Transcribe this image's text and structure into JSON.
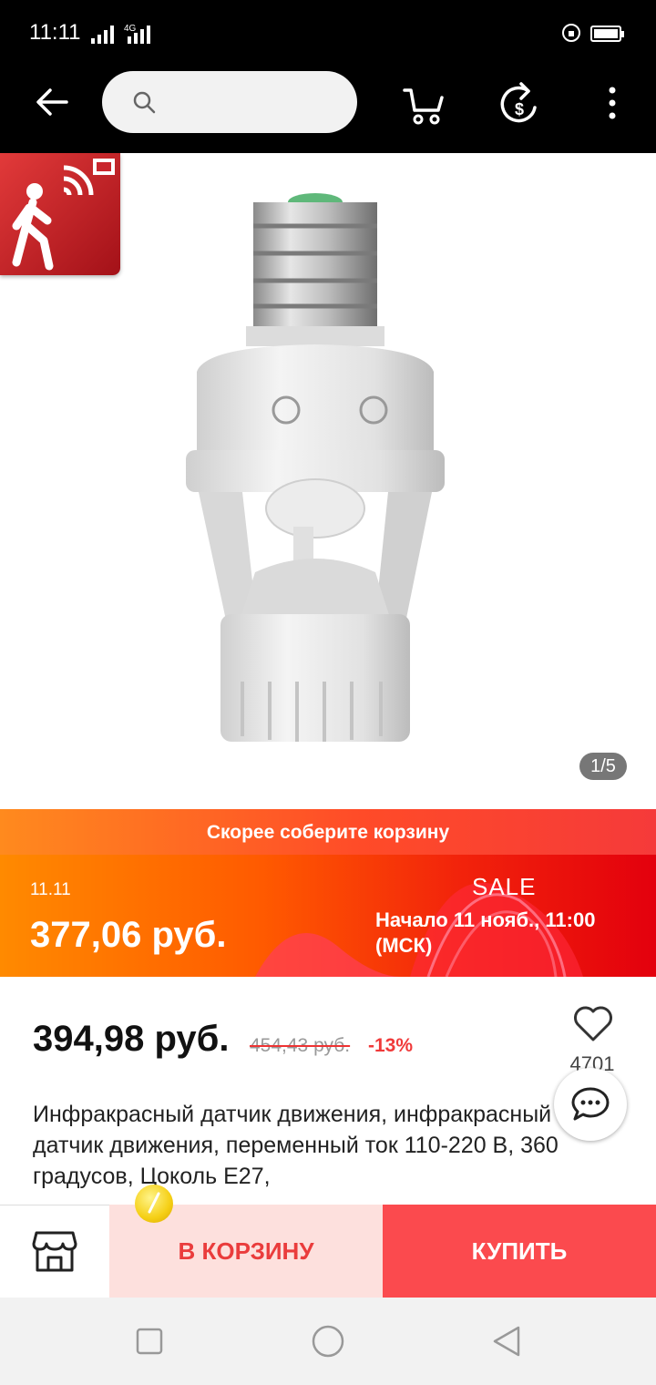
{
  "status_bar": {
    "time": "11:11",
    "network": "4G"
  },
  "search": {
    "placeholder": ""
  },
  "gallery": {
    "counter": "1/5"
  },
  "promo": {
    "banner_title": "Скорее соберите корзину",
    "date": "11.11",
    "price": "377,06 руб.",
    "sale": "SALE",
    "start": "Начало 11 нояб., 11:00 (МСК)"
  },
  "product": {
    "price": "394,98 руб.",
    "old_price": "454,43 руб.",
    "discount": "-13%",
    "likes": "4701",
    "title": "Инфракрасный датчик движения, инфракрасный датчик движения, переменный ток 110-220 В, 360 градусов, Цоколь E27,"
  },
  "actions": {
    "add_to_cart": "В КОРЗИНУ",
    "buy": "КУПИТЬ"
  },
  "colors": {
    "accent": "#fb4a4e",
    "cart_bg": "#fde0dd",
    "promo_orange": "#ff8a00",
    "promo_red": "#e3000d"
  }
}
